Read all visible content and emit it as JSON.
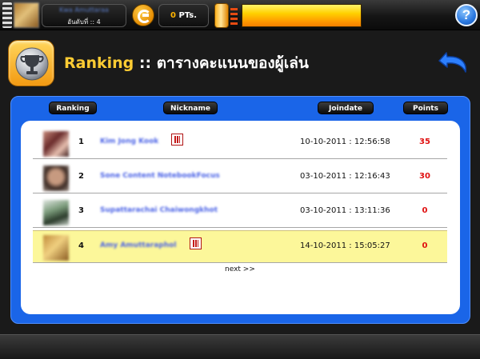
{
  "topbar": {
    "user_name": "Kwa Amuttaraa",
    "user_rank": "อันดับที่ :: 4",
    "points_value": "0",
    "points_unit": "PTs.",
    "energy_level": 1.0,
    "help_label": "?"
  },
  "header": {
    "title_prefix": "Ranking",
    "title_rest": " :: ตารางคะแนนของผู้เล่น"
  },
  "table": {
    "columns": [
      "Ranking",
      "Nickname",
      "Joindate",
      "Points"
    ],
    "rows": [
      {
        "rank": "1",
        "nickname": "Kim Jong Kook",
        "joindate": "10-10-2011 : 12:56:58",
        "points": "35"
      },
      {
        "rank": "2",
        "nickname": "Sone Content NotebookFocus",
        "joindate": "03-10-2011 : 12:16:43",
        "points": "30"
      },
      {
        "rank": "3",
        "nickname": "Supattarachai Chaiwongkhot",
        "joindate": "03-10-2011 : 13:11:36",
        "points": "0"
      },
      {
        "rank": "4",
        "nickname": "Amy Amuttaraphol",
        "joindate": "14-10-2011 : 15:05:27",
        "points": "0"
      }
    ],
    "next_label": "next >>"
  },
  "icons": {
    "trophy": "trophy-icon",
    "back": "back-arrow-icon",
    "coin": "c-coin-icon",
    "energy": "energy-can-icon",
    "badge": "game-badge-icon"
  },
  "colors": {
    "panel": "#1a65e8",
    "accent_title": "#ffcc33",
    "points": "#e01010",
    "highlight_row": "#fcf79a"
  }
}
